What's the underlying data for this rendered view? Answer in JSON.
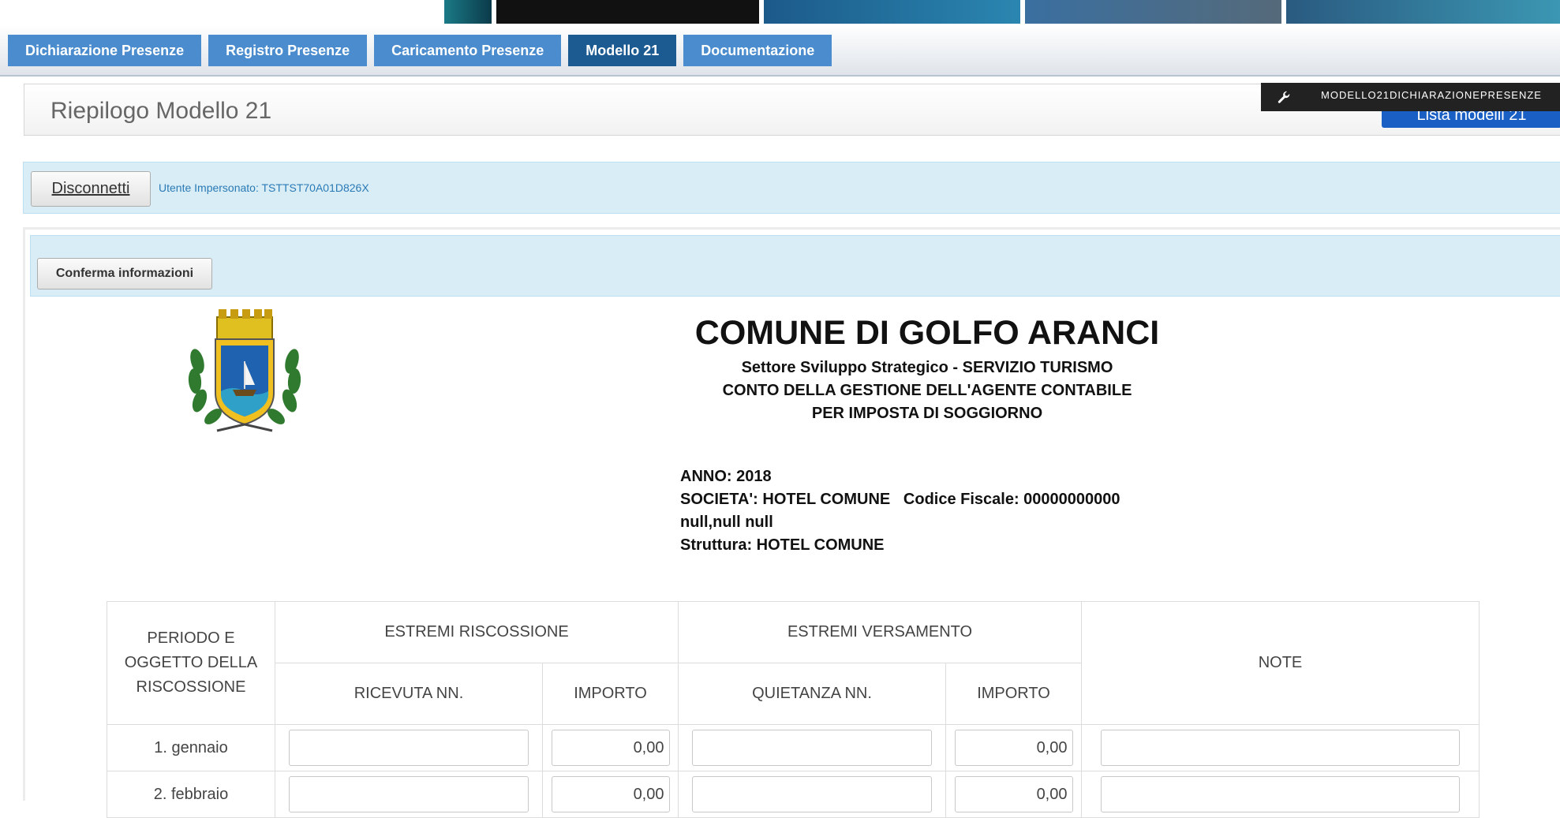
{
  "nav": {
    "items": [
      {
        "label": "Dichiarazione Presenze"
      },
      {
        "label": "Registro Presenze"
      },
      {
        "label": "Caricamento Presenze"
      },
      {
        "label": "Modello 21"
      },
      {
        "label": "Documentazione"
      }
    ],
    "active": "Modello 21"
  },
  "header": {
    "title": "Riepilogo Modello 21",
    "list_button": "Lista modelli 21",
    "tooltip": "MODELLO21DICHIARAZIONEPRESENZE"
  },
  "user_bar": {
    "disconnect_label": "Disconnetti",
    "user_label": "Utente Impersonato: TSTTST70A01D826X"
  },
  "confirm_label": "Conferma informazioni",
  "document": {
    "title": "COMUNE DI GOLFO ARANCI",
    "subtitle_lines": [
      "Settore Sviluppo Strategico - SERVIZIO TURISMO",
      "CONTO DELLA GESTIONE DELL'AGENTE CONTABILE",
      "PER IMPOSTA DI SOGGIORNO"
    ],
    "info_lines": [
      "ANNO: 2018",
      "SOCIETA': HOTEL COMUNE   Codice Fiscale: 00000000000",
      "null,null null",
      "Struttura: HOTEL COMUNE"
    ]
  },
  "table": {
    "col_periodo": "PERIODO E OGGETTO DELLA RISCOSSIONE",
    "group_riscossione": "ESTREMI RISCOSSIONE",
    "group_versamento": "ESTREMI VERSAMENTO",
    "col_note": "NOTE",
    "col_ricevuta": "RICEVUTA NN.",
    "col_importo_risc": "IMPORTO",
    "col_quietanza": "QUIETANZA NN.",
    "col_importo_vers": "IMPORTO",
    "rows": [
      {
        "period": "1. gennaio",
        "ricevuta": "",
        "importo_risc": "0,00",
        "quietanza": "",
        "importo_vers": "0,00",
        "note": ""
      },
      {
        "period": "2. febbraio",
        "ricevuta": "",
        "importo_risc": "0,00",
        "quietanza": "",
        "importo_vers": "0,00",
        "note": ""
      }
    ]
  },
  "colors": {
    "nav": "#4a8ccd",
    "nav_active": "#1c5b92",
    "info_bg": "#d9edf7",
    "primary": "#1a5fc4"
  }
}
